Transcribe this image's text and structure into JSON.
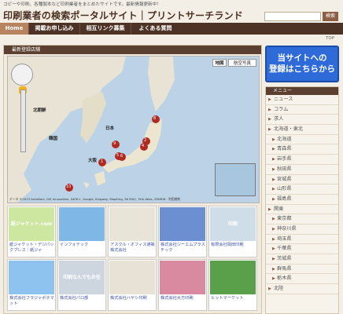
{
  "header": {
    "tagline": "コピーや印刷、各種製本など印刷業者をまとめたサイトです。最新情報更新中！",
    "title": "印刷業者の検索ポータルサイト｜プリントサーチランド",
    "search_button": "検索"
  },
  "nav": {
    "items": [
      "Home",
      "掲載お申し込み",
      "相互リンク募集",
      "よくある質問"
    ]
  },
  "top_link": "TOP",
  "main": {
    "section_title": "最新登録店舗",
    "map": {
      "type_buttons": [
        "地図",
        "航空写真"
      ],
      "labels": {
        "north_korea": "北朝鮮",
        "south_korea": "韓国",
        "japan": "日本",
        "osaka": "大阪"
      },
      "markers": [
        "9",
        "5",
        "8",
        "4",
        "2",
        "6",
        "1",
        "10"
      ],
      "footer": "データ ©2013 AutoNavi, GIS Innovatiios, DATA+, Google, Kingway, MapKing, SK M&C, Tele Atlas, ZENRIN · 利用規約"
    },
    "listings": [
      {
        "caption": "紙ジャケット・デジパックプレス｜紙ジャ",
        "thumb": "紙ジャケット.com",
        "thumb_color": "#cde6a0"
      },
      {
        "caption": "インフォテック",
        "thumb": "",
        "thumb_color": "#7fb8e6"
      },
      {
        "caption": "アスクル・オフィス通販株式会社",
        "thumb": "",
        "thumb_color": "#e9e4d8"
      },
      {
        "caption": "株式会社ジーエムプラスチック",
        "thumb": "",
        "thumb_color": "#6b8fd1"
      },
      {
        "caption": "有限会社岡田印刷",
        "thumb": "印刷",
        "thumb_color": "#cfdde8"
      },
      {
        "caption": "株式会社フラジャポネマット",
        "thumb": "",
        "thumb_color": "#8ec3f0"
      },
      {
        "caption": "株式会社パロ部",
        "thumb": "印刷なんでもお任せ！",
        "thumb_color": "#cdd6df"
      },
      {
        "caption": "株式会社ハヤシ印刷",
        "thumb": "",
        "thumb_color": "#e8e2d6"
      },
      {
        "caption": "株式会社大方印刷",
        "thumb": "",
        "thumb_color": "#d98aa0"
      },
      {
        "caption": "ヒットマーケット",
        "thumb": "",
        "thumb_color": "#5aa04a"
      }
    ]
  },
  "register_button": "当サイトへの\n登録はこちらから",
  "sidebar": {
    "title": "メニュー",
    "items": [
      {
        "label": "ニュース",
        "sub": false
      },
      {
        "label": "コラム",
        "sub": false
      },
      {
        "label": "求人",
        "sub": false
      },
      {
        "label": "北海道・東北",
        "sub": false
      },
      {
        "label": "北海道",
        "sub": true
      },
      {
        "label": "青森県",
        "sub": true
      },
      {
        "label": "岩手県",
        "sub": true
      },
      {
        "label": "秋田県",
        "sub": true
      },
      {
        "label": "宮城県",
        "sub": true
      },
      {
        "label": "山形県",
        "sub": true
      },
      {
        "label": "福島県",
        "sub": true
      },
      {
        "label": "関東",
        "sub": false
      },
      {
        "label": "東京都",
        "sub": true
      },
      {
        "label": "神奈川県",
        "sub": true
      },
      {
        "label": "埼玉県",
        "sub": true
      },
      {
        "label": "千葉県",
        "sub": true
      },
      {
        "label": "茨城県",
        "sub": true
      },
      {
        "label": "群馬県",
        "sub": true
      },
      {
        "label": "栃木県",
        "sub": true
      },
      {
        "label": "北陸",
        "sub": false
      }
    ]
  },
  "colors": {
    "nav": "#4d3326",
    "accent": "#b8845f",
    "register": "#2f6bd8",
    "marker": "#b02a22"
  }
}
